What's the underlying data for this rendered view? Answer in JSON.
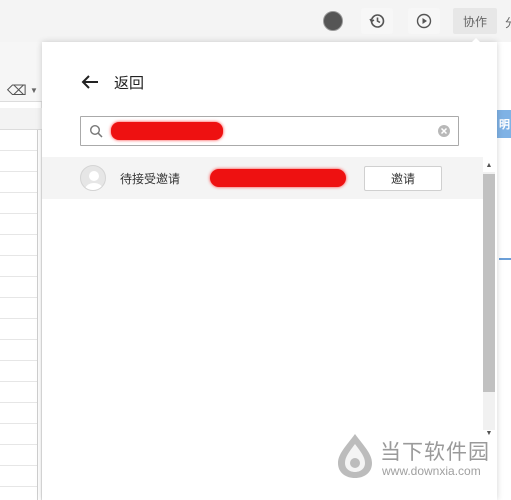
{
  "topbar": {
    "collab_label": "协作",
    "edge_text": "分",
    "icons": [
      "avatar",
      "history-icon",
      "play-icon"
    ]
  },
  "panel": {
    "back_label": "返回",
    "search": {
      "value": "",
      "redacted": true
    },
    "results": [
      {
        "status": "待接受邀请",
        "name_redacted": true,
        "action_label": "邀请"
      }
    ]
  },
  "background": {
    "right_edge_text": "明"
  },
  "watermark": {
    "title": "当下软件园",
    "url": "www.downxia.com"
  },
  "colors": {
    "redaction": "#ee1111",
    "accent_blue": "#7fb2e5"
  }
}
